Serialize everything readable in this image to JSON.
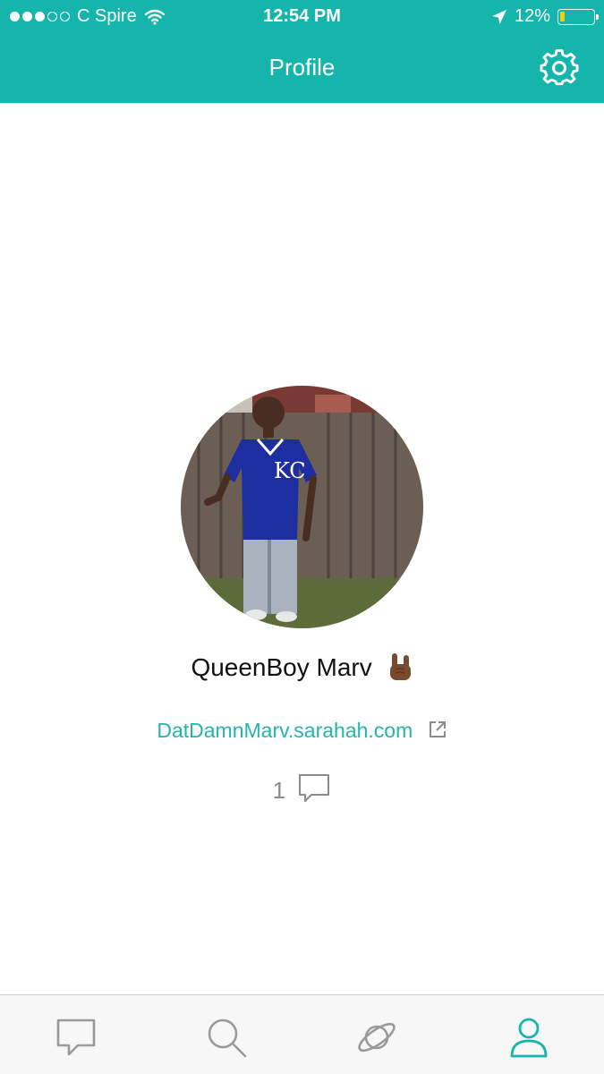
{
  "status_bar": {
    "carrier": "C Spire",
    "time": "12:54 PM",
    "battery": "12%"
  },
  "nav": {
    "title": "Profile",
    "settings_icon": "gear-icon"
  },
  "profile": {
    "name": "QueenBoy Marv",
    "name_emoji": "sign-of-the-horns-emoji",
    "link": "DatDamnMarv.sarahah.com",
    "message_count": "1"
  },
  "tabbar": {
    "active_tab": "profile",
    "tabs": [
      {
        "id": "messages",
        "icon": "chat-bubble-icon"
      },
      {
        "id": "search",
        "icon": "search-icon"
      },
      {
        "id": "explore",
        "icon": "planet-icon"
      },
      {
        "id": "profile",
        "icon": "user-icon"
      }
    ]
  },
  "colors": {
    "accent": "#16b5ac",
    "link": "#26b3ab",
    "tab_inactive": "#9a9a9a",
    "battery_fill": "#f5d000"
  }
}
